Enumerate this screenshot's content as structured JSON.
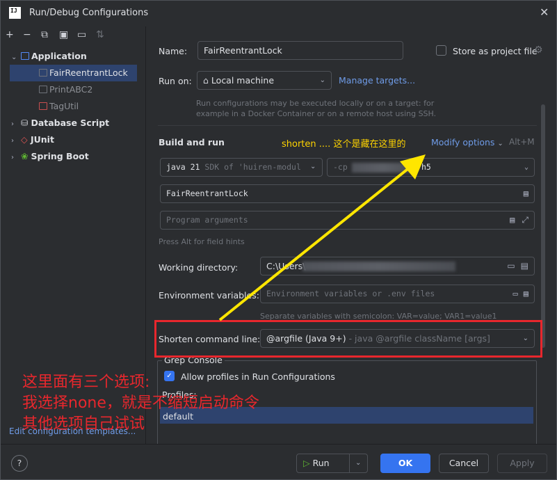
{
  "window": {
    "title": "Run/Debug Configurations",
    "app_icon": "IJ"
  },
  "toolbar": {
    "icons": [
      "add-icon",
      "remove-icon",
      "copy-icon",
      "save-icon",
      "folder-add-icon",
      "sort-icon"
    ]
  },
  "tree": {
    "items": [
      {
        "label": "Application",
        "expanded": true
      },
      {
        "label": "FairReentrantLock",
        "selected": true
      },
      {
        "label": "PrintABC2"
      },
      {
        "label": "TagUtil"
      },
      {
        "label": "Database Script"
      },
      {
        "label": "JUnit"
      },
      {
        "label": "Spring Boot"
      }
    ],
    "edit_templates": "Edit configuration templates..."
  },
  "form": {
    "name_label": "Name:",
    "name_value": "FairReentrantLock",
    "store_label": "Store as project file",
    "run_on_label": "Run on:",
    "run_on_value": "Local machine",
    "manage_targets": "Manage targets...",
    "run_on_hint": "Run configurations may be executed locally or on a target: for example in a Docker Container or on a remote host using SSH.",
    "build_run_label": "Build and run",
    "modify_options": "Modify options",
    "modify_shortcut": "Alt+M",
    "sdk_value": "java 21",
    "sdk_suffix": "SDK of 'huiren-modul",
    "cp_value": "-cp",
    "cp_suffix": "h5",
    "main_class": "FairReentrantLock",
    "program_args_placeholder": "Program arguments",
    "field_hint": "Press Alt for field hints",
    "workdir_label": "Working directory:",
    "workdir_value": "C:\\Users\\",
    "env_label": "Environment variables:",
    "env_placeholder": "Environment variables or .env files",
    "env_hint": "Separate variables with semicolon: VAR=value; VAR1=value1",
    "shorten_label": "Shorten command line:",
    "shorten_value": "@argfile (Java 9+)",
    "shorten_hint": "- java @argfile className [args]",
    "grep_title": "Grep Console",
    "allow_profiles": "Allow profiles in Run Configurations",
    "profiles_label": "Profiles:",
    "profile_default": "default"
  },
  "buttons": {
    "help": "?",
    "run": "Run",
    "ok": "OK",
    "cancel": "Cancel",
    "apply": "Apply"
  },
  "annotations": {
    "yellow_note": "shorten .... 这个是藏在这里的",
    "red_line1": "这里面有三个选项:",
    "red_line2": "我选择none，就是不缩短启动命令",
    "red_line3": "其他选项自己试试"
  },
  "colors": {
    "accent": "#3574f0",
    "selection": "#2e436e",
    "annotation_red": "#e8272d",
    "annotation_yellow": "#ffd400",
    "link": "#6f9ce8"
  }
}
